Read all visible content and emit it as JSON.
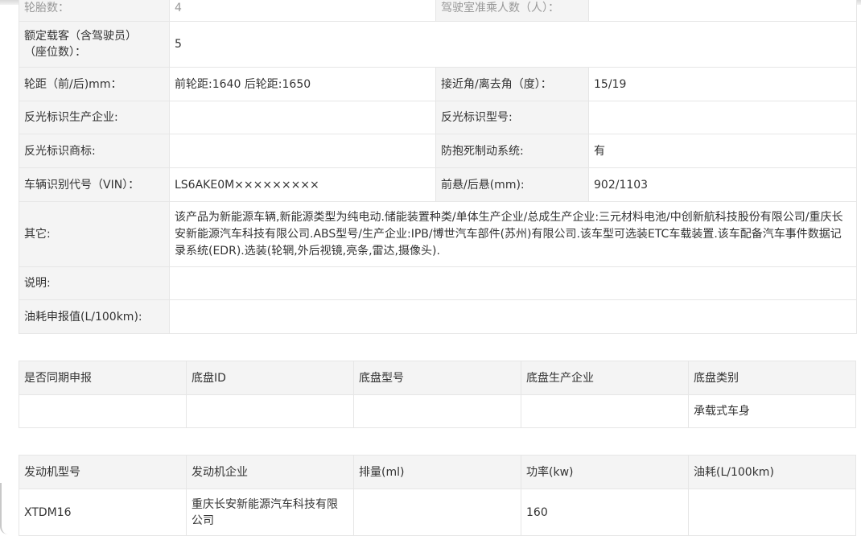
{
  "vehicle_specs": {
    "partial_row": {
      "label": "轮胎数：",
      "value": "4",
      "label2": "驾驶室准乘人数（人）：",
      "value2": ""
    },
    "seats": {
      "label_line1": "额定载客（含驾驶员）",
      "label_line2": "（座位数）：",
      "value": "5"
    },
    "track": {
      "label": "轮距（前/后)mm：",
      "value": "前轮距:1640 后轮距:1650",
      "label2": "接近角/离去角（度）：",
      "value2": "15/19"
    },
    "reflector_maker": {
      "label": "反光标识生产企业:",
      "value": "",
      "label2": "反光标识型号:",
      "value2": ""
    },
    "reflector_brand": {
      "label": "反光标识商标:",
      "value": "",
      "label2": "防抱死制动系统:",
      "value2": "有"
    },
    "vin": {
      "label": "车辆识别代号（VIN）：",
      "value": "LS6AKE0M×××××××××",
      "label2": "前悬/后悬(mm):",
      "value2": "902/1103"
    },
    "other": {
      "label": "其它:",
      "value": "该产品为新能源车辆,新能源类型为纯电动.储能装置种类/单体生产企业/总成生产企业:三元材料电池/中创新航科技股份有限公司/重庆长安新能源汽车科技有限公司.ABS型号/生产企业:IPB/博世汽车部件(苏州)有限公司.该车型可选装ETC车载装置.该车配备汽车事件数据记录系统(EDR).选装(轮辋,外后视镜,亮条,雷达,摄像头)."
    },
    "note": {
      "label": "说明:",
      "value": ""
    },
    "fuel": {
      "label": "油耗申报值(L/100km):",
      "value": ""
    }
  },
  "chassis": {
    "headers": [
      "是否同期申报",
      "底盘ID",
      "底盘型号",
      "底盘生产企业",
      "底盘类别"
    ],
    "row": [
      "",
      "",
      "",
      "",
      "承载式车身"
    ]
  },
  "engine": {
    "headers": [
      "发动机型号",
      "发动机企业",
      "排量(ml)",
      "功率(kw)",
      "油耗(L/100km)"
    ],
    "row": [
      "XTDM16",
      "重庆长安新能源汽车科技有限公司",
      "",
      "160",
      ""
    ]
  }
}
